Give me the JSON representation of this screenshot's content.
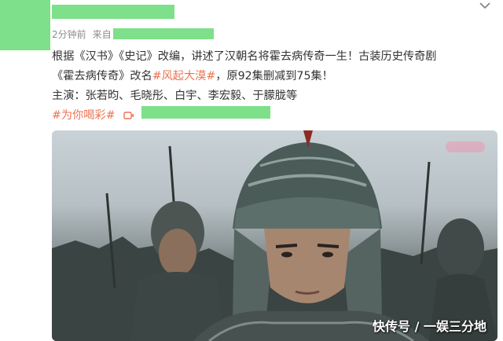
{
  "post": {
    "time": "2分钟前",
    "from_label": "来自",
    "body_line1": "根据《汉书》《史记》改编，讲述了汉朝名将霍去病传奇一生！古装历史传奇剧",
    "body_line2_prefix": "《霍去病传奇》改名",
    "body_line2_hashtag": "#风起大漠#",
    "body_line2_suffix": "，原92集删减到75集！",
    "body_line3": "主演：张若昀、毛晓彤、白宇、李宏毅、于朦胧等",
    "topic_hashtag": "#为你喝彩#"
  },
  "media": {
    "watermark": "快传号 / 一娱三分地"
  },
  "icons": {
    "menu": "chevron-down-icon",
    "link": "video-link-icon"
  },
  "colors": {
    "redaction": "#7ee08a",
    "hashtag": "#eb7350",
    "meta": "#8c8c8c",
    "text": "#333333"
  }
}
